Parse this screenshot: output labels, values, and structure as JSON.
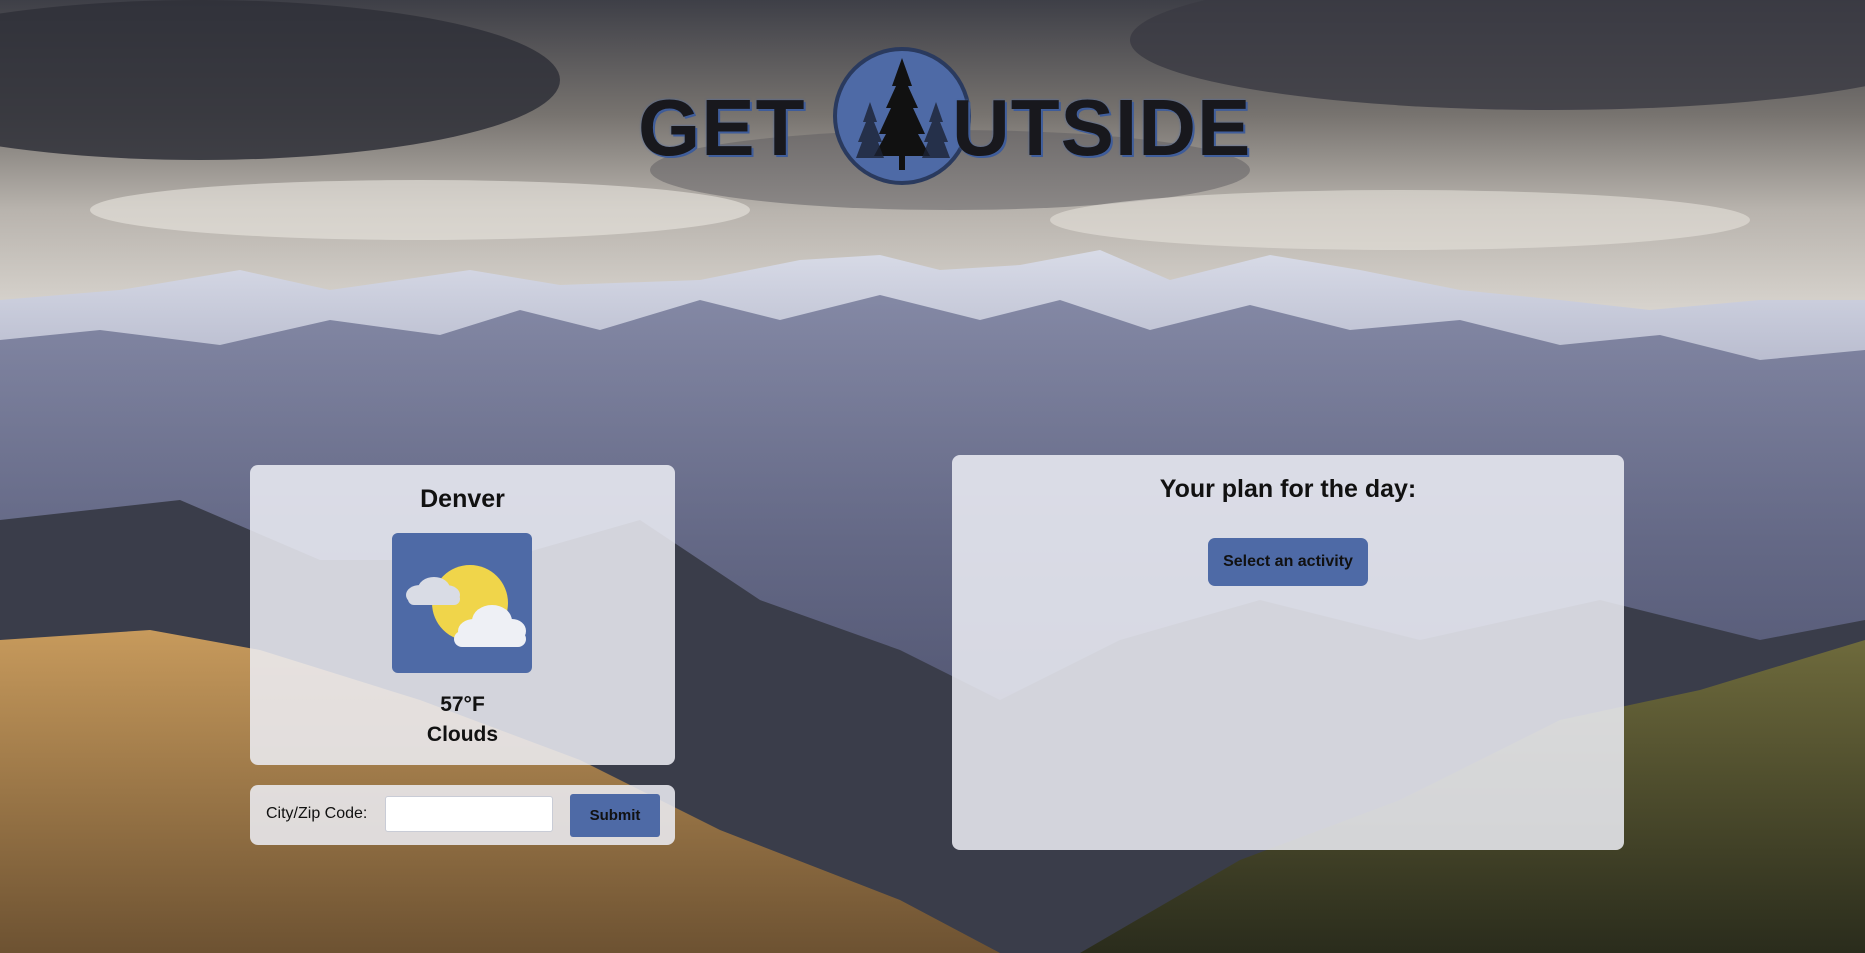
{
  "app": {
    "logo_text_left": "GET",
    "logo_text_right": "UTSIDE",
    "brand_color": "#4e6aa6"
  },
  "weather": {
    "city": "Denver",
    "icon": "partly-cloudy-icon",
    "temperature": "57°F",
    "condition": "Clouds"
  },
  "search": {
    "label": "City/Zip Code:",
    "value": "",
    "placeholder": "",
    "submit_label": "Submit"
  },
  "plan": {
    "title": "Your plan for the day:",
    "activity_button_label": "Select an activity"
  }
}
